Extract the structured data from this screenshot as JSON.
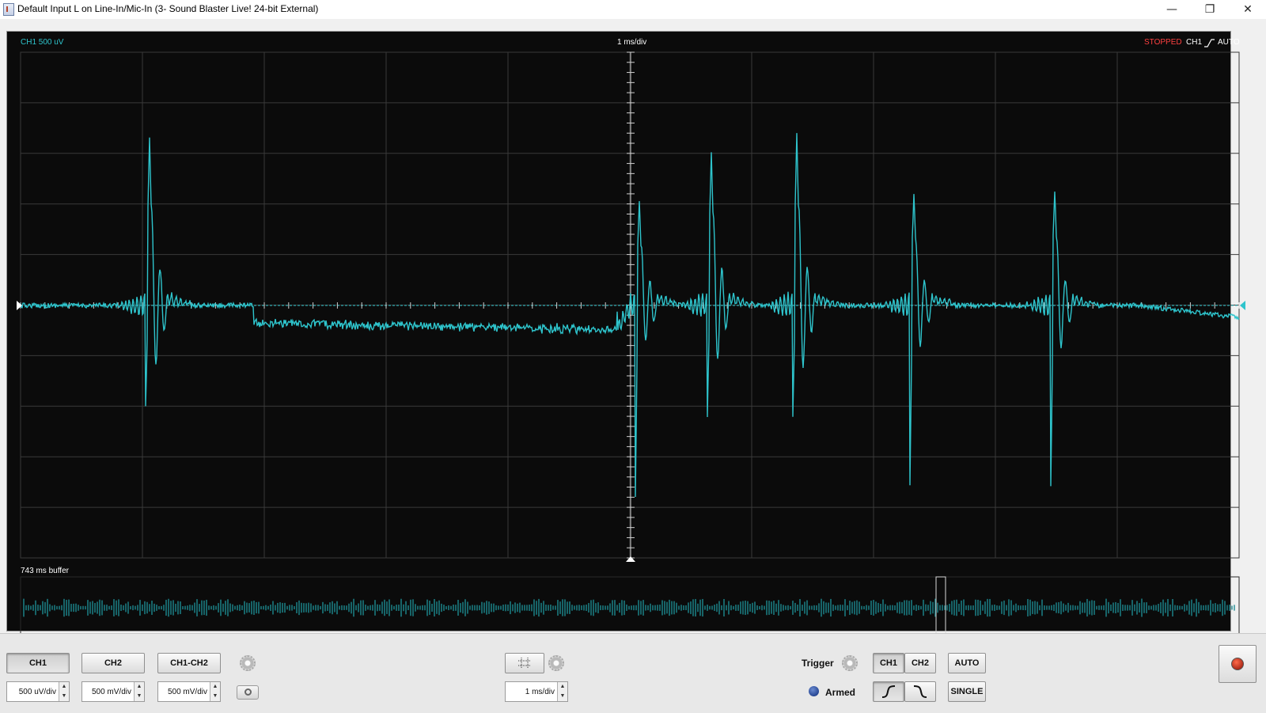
{
  "window": {
    "title": "Default Input L on Line-In/Mic-In (3- Sound Blaster Live! 24-bit External)",
    "minimize_glyph": "—",
    "restore_glyph": "❐",
    "close_glyph": "✕"
  },
  "scope": {
    "channel_label": "CH1 500 uV",
    "timebase_label": "1 ms/div",
    "status": "STOPPED",
    "trigger_channel": "CH1",
    "trigger_mode": "AUTO",
    "buffer_label": "743 ms buffer",
    "trace_color": "#2ec4cc",
    "status_color": "#ff4040"
  },
  "controls": {
    "ch1_button": "CH1",
    "ch2_button": "CH2",
    "diff_button": "CH1-CH2",
    "ch1_scale": "500 uV/div",
    "ch2_scale": "500 mV/div",
    "diff_scale": "500 mV/div",
    "timebase_scale": "1 ms/div",
    "trigger_label": "Trigger",
    "armed_label": "Armed",
    "trig_ch1_button": "CH1",
    "trig_ch2_button": "CH2",
    "auto_button": "AUTO",
    "single_button": "SINGLE",
    "arrow_up": "▲",
    "arrow_down": "▼"
  }
}
